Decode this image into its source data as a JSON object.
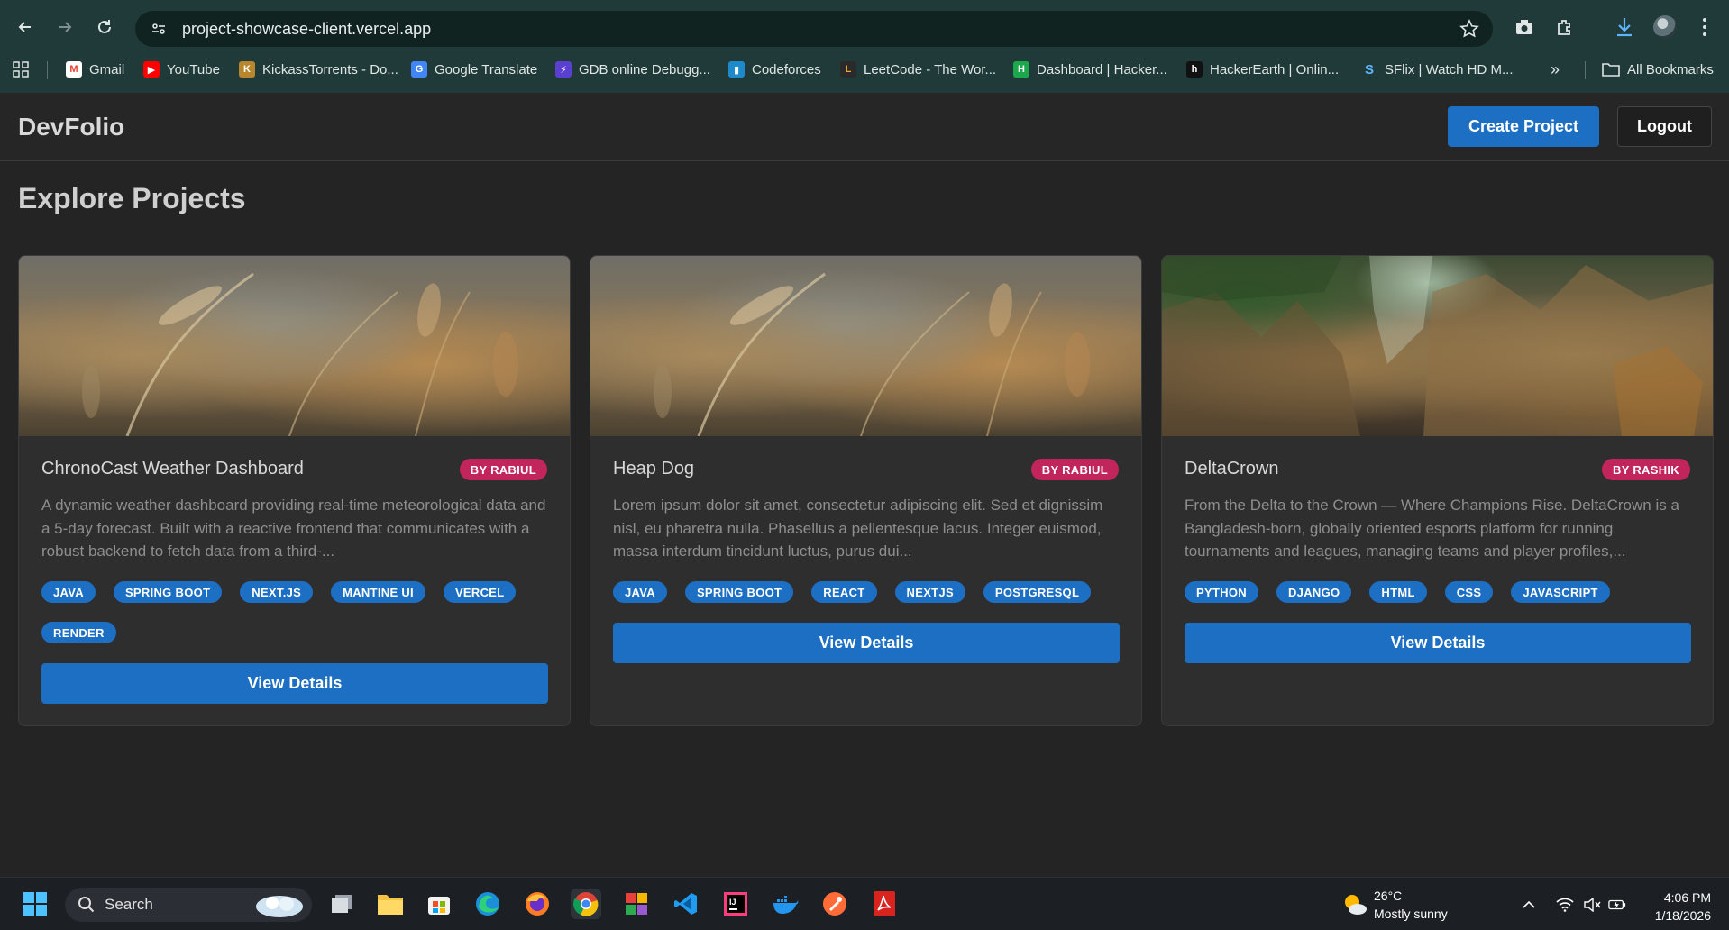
{
  "browser": {
    "url": "project-showcase-client.vercel.app",
    "bookmarks": [
      {
        "label": "Gmail",
        "color": "#ea4335",
        "glyph": "M"
      },
      {
        "label": "YouTube",
        "color": "#ff0000",
        "glyph": "▶"
      },
      {
        "label": "KickassTorrents - Do...",
        "color": "#b8862d",
        "glyph": "K"
      },
      {
        "label": "Google Translate",
        "color": "#4285f4",
        "glyph": "G"
      },
      {
        "label": "GDB online Debugg...",
        "color": "#5b3fd1",
        "glyph": "⚡"
      },
      {
        "label": "Codeforces",
        "color": "#1f8acb",
        "glyph": "▮"
      },
      {
        "label": "LeetCode - The Wor...",
        "color": "#1f1f1f",
        "glyph": "L"
      },
      {
        "label": "Dashboard | Hacker...",
        "color": "#1ba94c",
        "glyph": "H"
      },
      {
        "label": "HackerEarth | Onlin...",
        "color": "#1f1f1f",
        "glyph": "h"
      },
      {
        "label": "SFlix | Watch HD M...",
        "color": "#1f3a38",
        "glyph": "S"
      }
    ],
    "more_label": "»",
    "all_bookmarks": "All Bookmarks"
  },
  "app": {
    "brand": "DevFolio",
    "create_label": "Create Project",
    "logout_label": "Logout",
    "page_title": "Explore Projects",
    "view_label": "View Details"
  },
  "projects": [
    {
      "title": "ChronoCast Weather Dashboard",
      "author": "BY RABIUL",
      "description": "A dynamic weather dashboard providing real-time meteorological data and a 5-day forecast. Built with a reactive frontend that communicates with a robust backend to fetch data from a third-...",
      "tags": [
        "JAVA",
        "SPRING BOOT",
        "NEXT.JS",
        "MANTINE UI",
        "VERCEL",
        "RENDER"
      ],
      "image": "wheat"
    },
    {
      "title": "Heap Dog",
      "author": "BY RABIUL",
      "description": "Lorem ipsum dolor sit amet, consectetur adipiscing elit. Sed et dignissim nisl, eu pharetra nulla. Phasellus a pellentesque lacus. Integer euismod, massa interdum tincidunt luctus, purus dui...",
      "tags": [
        "JAVA",
        "SPRING BOOT",
        "REACT",
        "NEXTJS",
        "POSTGRESQL"
      ],
      "image": "wheat"
    },
    {
      "title": "DeltaCrown",
      "author": "BY RASHIK",
      "description": "From the Delta to the Crown — Where Champions Rise. DeltaCrown is a Bangladesh-born, globally oriented esports platform for running tournaments and leagues, managing teams and player profiles,...",
      "tags": [
        "PYTHON",
        "DJANGO",
        "HTML",
        "CSS",
        "JAVASCRIPT"
      ],
      "image": "rock"
    }
  ],
  "taskbar": {
    "search_label": "Search",
    "weather_temp": "26°C",
    "weather_cond": "Mostly sunny",
    "time": "4:06 PM",
    "date": "1/18/2026"
  },
  "colors": {
    "accent": "#1d6fc3",
    "badge": "#c2255c",
    "background": "#242424",
    "card": "#2e2e2e"
  }
}
